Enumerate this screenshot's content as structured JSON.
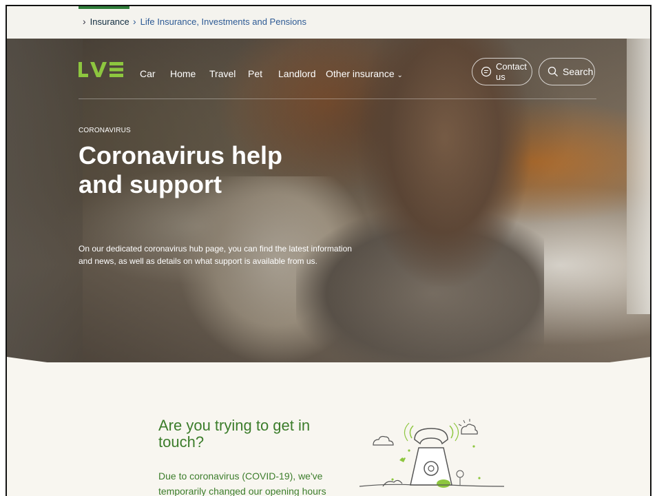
{
  "breadcrumb": {
    "active": "Insurance",
    "link": "Life Insurance, Investments and Pensions"
  },
  "nav": {
    "logo_text": "LV=",
    "items": [
      "Car",
      "Home",
      "Travel",
      "Pet",
      "Landlord",
      "Other insurance"
    ],
    "contact_label": "Contact us",
    "search_label": "Search"
  },
  "hero": {
    "eyebrow": "CORONAVIRUS",
    "title": "Coronavirus help and support",
    "text": "On our dedicated coronavirus hub page, you can find the latest information and news, as well as details on what support is available from us."
  },
  "contact_section": {
    "title": "Are you trying to get in touch?",
    "text": "Due to coronavirus (COVID-19), we've temporarily changed our opening hours"
  },
  "colors": {
    "brand_green": "#8dc63f",
    "text_green": "#3c7d2b",
    "link_blue": "#2d5a94",
    "section_bg": "#f8f6f0"
  },
  "icons": [
    "chevron-right-icon",
    "chat-bubble-icon",
    "search-icon",
    "chevron-down-icon",
    "telephone-illustration"
  ]
}
